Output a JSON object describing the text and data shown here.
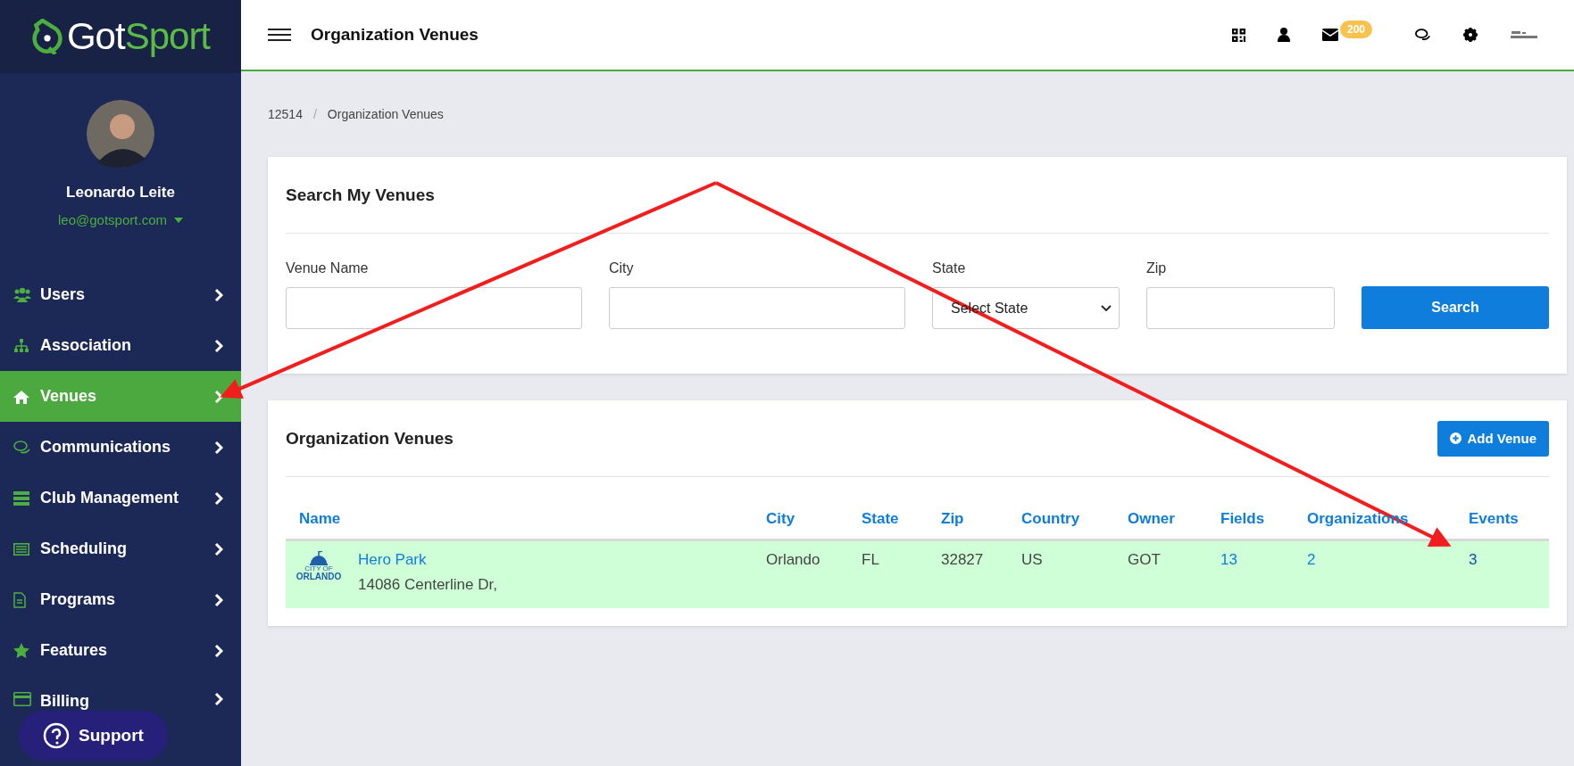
{
  "brand": {
    "first": "Got",
    "second": "Sport"
  },
  "user": {
    "name": "Leonardo Leite",
    "email": "leo@gotsport.com"
  },
  "sidebar": {
    "items": [
      {
        "label": "Users",
        "selected": false
      },
      {
        "label": "Association",
        "selected": false
      },
      {
        "label": "Venues",
        "selected": true
      },
      {
        "label": "Communications",
        "selected": false
      },
      {
        "label": "Club Management",
        "selected": false
      },
      {
        "label": "Scheduling",
        "selected": false
      },
      {
        "label": "Programs",
        "selected": false
      },
      {
        "label": "Features",
        "selected": false
      },
      {
        "label": "Billing",
        "selected": false
      }
    ]
  },
  "support": {
    "label": "Support"
  },
  "header": {
    "title": "Organization Venues",
    "mail_badge": "200"
  },
  "breadcrumb": {
    "items": [
      "12514",
      "Organization Venues"
    ],
    "separator": "/"
  },
  "search_card": {
    "title": "Search My Venues",
    "fields": [
      {
        "kind": "text",
        "label": "Venue Name"
      },
      {
        "kind": "text",
        "label": "City"
      },
      {
        "kind": "select",
        "label": "State",
        "value": "Select State"
      },
      {
        "kind": "text",
        "label": "Zip"
      }
    ],
    "button": "Search"
  },
  "venues_card": {
    "title": "Organization Venues",
    "add_button": "Add Venue",
    "table": {
      "columns": [
        "Name",
        "City",
        "State",
        "Zip",
        "Country",
        "Owner",
        "Fields",
        "Organizations",
        "Events"
      ],
      "rows": [
        {
          "logo": {
            "line1": "CITY OF",
            "line2": "ORLANDO"
          },
          "name": "Hero Park",
          "address": "14086 Centerline Dr,",
          "city": "Orlando",
          "state": "FL",
          "zip": "32827",
          "country": "US",
          "owner": "GOT",
          "fields": "13",
          "organizations": "2",
          "events": "3",
          "selected": true
        }
      ]
    }
  }
}
